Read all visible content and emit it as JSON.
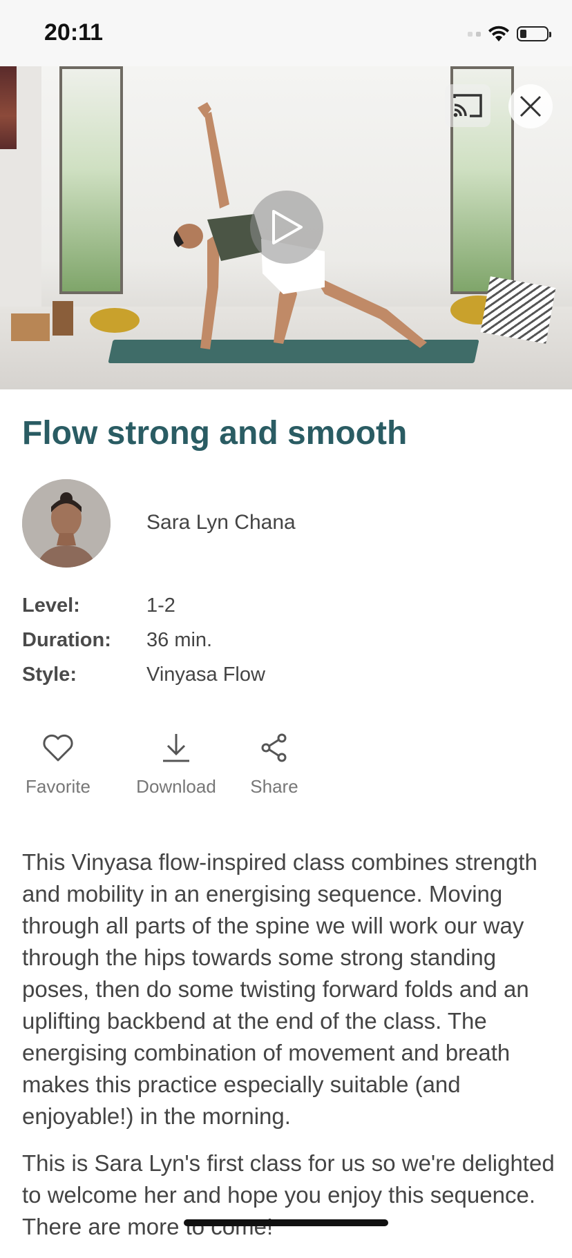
{
  "status_bar": {
    "time": "20:11"
  },
  "video": {
    "cast_icon": "cast-icon",
    "close_icon": "close-icon",
    "play_icon": "play-icon"
  },
  "class": {
    "title": "Flow strong and smooth",
    "instructor": "Sara Lyn Chana",
    "meta": [
      {
        "key": "Level:",
        "value": "1-2"
      },
      {
        "key": "Duration:",
        "value": "36 min."
      },
      {
        "key": "Style:",
        "value": "Vinyasa Flow"
      }
    ]
  },
  "actions": {
    "favorite": "Favorite",
    "download": "Download",
    "share": "Share"
  },
  "description": {
    "paragraph1": "This Vinyasa flow-inspired class combines strength and mobility in an energising sequence. Moving through all parts of the spine we will work our way through the hips towards some strong standing poses, then do some twisting forward folds and an uplifting backbend at the end of the class. The energising combination of movement and breath makes this practice especially suitable (and enjoyable!) in the morning.",
    "paragraph2": "This is Sara Lyn's first class for us so we're delighted to welcome her and hope you enjoy this sequence. There are more to come!"
  }
}
